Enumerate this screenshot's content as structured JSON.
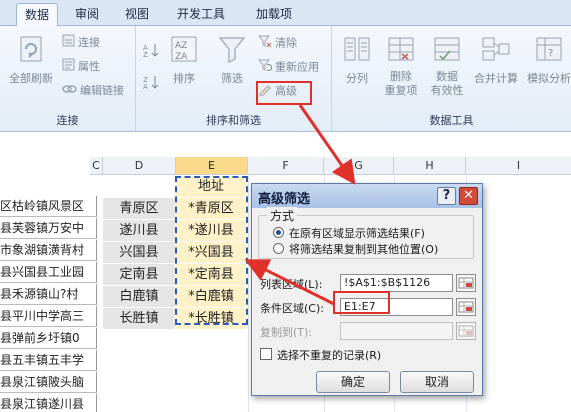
{
  "tabs": [
    "数据",
    "审阅",
    "视图",
    "开发工具",
    "加载项"
  ],
  "active_tab": 0,
  "ribbon": {
    "connections": {
      "label": "连接",
      "refresh_all": "全部刷新",
      "connections": "连接",
      "properties": "属性",
      "edit_links": "编辑链接"
    },
    "sort_filter": {
      "label": "排序和筛选",
      "sort": "排序",
      "filter": "筛选",
      "clear": "清除",
      "reapply": "重新应用",
      "advanced": "高级"
    },
    "data_tools": {
      "label": "数据工具",
      "split": "分列",
      "remove_dup_line1": "删除",
      "remove_dup_line2": "重复项",
      "validation_line1": "数据",
      "validation_line2": "有效性",
      "consolidate": "合并计算",
      "what_if": "模拟分析"
    }
  },
  "sheet": {
    "columns": [
      "C",
      "D",
      "E",
      "F",
      "G",
      "H",
      "I"
    ],
    "col_a_values": [
      "区枯岭镇风景区",
      "县芙蓉镇万安中",
      "市象湖镇潢背村",
      "县兴国县工业园",
      "县禾源镇山?村",
      "县平川中学高三",
      "县弹前乡圩镇0",
      "县五丰镇五丰学",
      "县泉江镇陂头脑",
      "县泉江镇遂川县"
    ],
    "col_d_values": [
      "青原区",
      "遂川县",
      "兴国县",
      "定南县",
      "白鹿镇",
      "长胜镇"
    ],
    "col_e_header": "地址",
    "col_e_values": [
      "*青原区",
      "*遂川县",
      "*兴国县",
      "*定南县",
      "*白鹿镇",
      "*长胜镇"
    ]
  },
  "dialog": {
    "title": "高级筛选",
    "help": "?",
    "close": "✕",
    "method_label": "方式",
    "option_in_place": "在原有区域显示筛选结果(F)",
    "option_copy": "将筛选结果复制到其他位置(O)",
    "list_range_label": "列表区域(L):",
    "list_range_value": "!$A$1:$B$1126",
    "criteria_label": "条件区域(C):",
    "criteria_value": "E1:E7",
    "copy_to_label": "复制到(T):",
    "copy_to_value": "",
    "unique_label": "选择不重复的记录(R)",
    "ok": "确定",
    "cancel": "取消"
  },
  "colors": {
    "highlight": "#e0302a",
    "selection_border": "#2a5bb6",
    "ribbon_bg": "#e4ecf7"
  }
}
